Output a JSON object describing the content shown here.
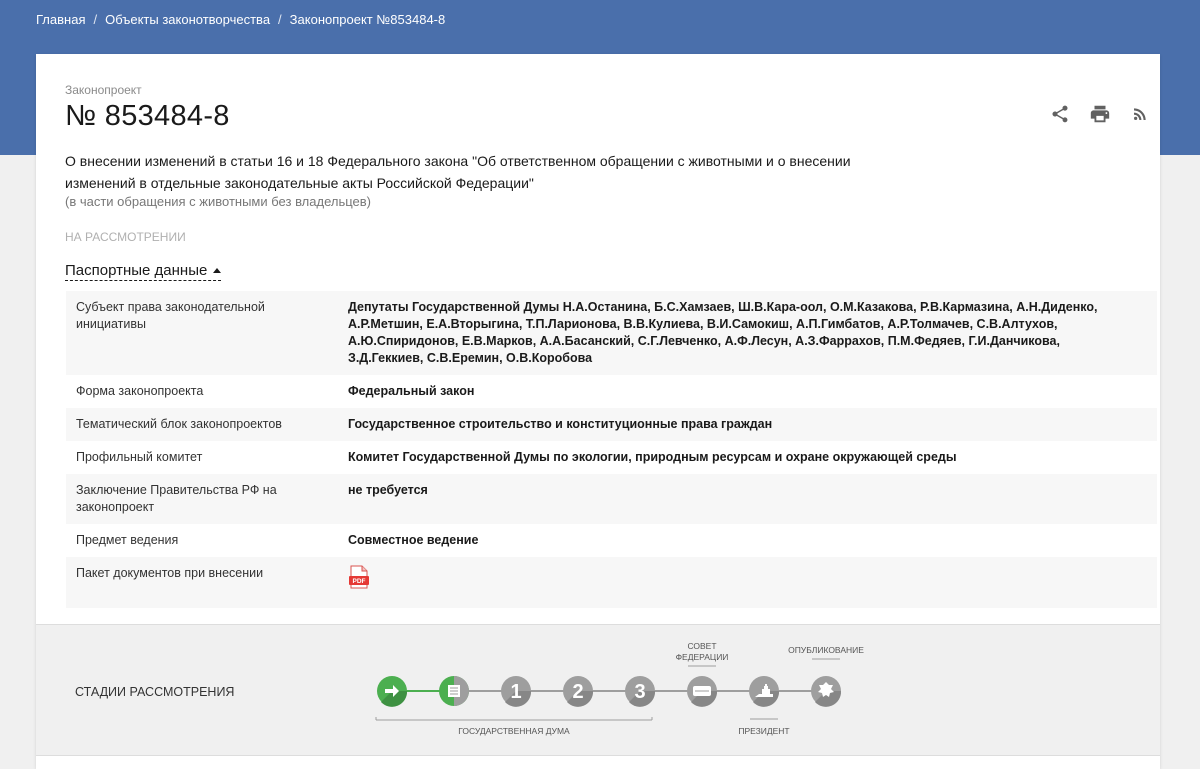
{
  "breadcrumb": [
    {
      "label": "Главная"
    },
    {
      "label": "Объекты законотворчества"
    },
    {
      "label": "Законопроект №853484-8"
    }
  ],
  "doc": {
    "type_label": "Законопроект",
    "number": "№ 853484-8",
    "title": "О внесении изменений в статьи 16 и 18 Федерального закона \"Об ответственном обращении с животными и о внесении изменений в отдельные законодательные акты Российской Федерации\"",
    "subtitle": "(в части обращения с животными без владельцев)",
    "status": "НА РАССМОТРЕНИИ"
  },
  "actions": {
    "share_icon": "share-icon",
    "print_icon": "print-icon",
    "rss_icon": "rss-icon"
  },
  "passport": {
    "toggle_label": "Паспортные данные",
    "rows": [
      {
        "label": "Субъект права законодательной инициативы",
        "value": "Депутаты Государственной Думы Н.А.Останина, Б.С.Хамзаев, Ш.В.Кара-оол, О.М.Казакова, Р.В.Кармазина, А.Н.Диденко, А.Р.Метшин, Е.А.Вторыгина, Т.П.Ларионова, В.В.Кулиева, В.И.Самокиш, А.П.Гимбатов, А.Р.Толмачев, С.В.Алтухов, А.Ю.Спиридонов, Е.В.Марков, А.А.Басанский, С.Г.Левченко, А.Ф.Лесун, А.З.Фаррахов, П.М.Федяев, Г.И.Данчикова, З.Д.Геккиев, С.В.Еремин, О.В.Коробова"
      },
      {
        "label": "Форма законопроекта",
        "value": "Федеральный закон"
      },
      {
        "label": "Тематический блок законопроектов",
        "value": "Государственное строительство и конституционные права граждан"
      },
      {
        "label": "Профильный комитет",
        "value": "Комитет Государственной Думы по экологии, природным ресурсам и охране окружающей среды"
      },
      {
        "label": "Заключение Правительства РФ на законопроект",
        "value": "не требуется"
      },
      {
        "label": "Предмет ведения",
        "value": "Совместное ведение"
      },
      {
        "label": "Пакет документов при внесении",
        "value": ""
      }
    ],
    "pdf_label": "PDF"
  },
  "stages": {
    "label": "СТАДИИ РАССМОТРЕНИЯ",
    "duma_label": "ГОСУДАРСТВЕННАЯ ДУМА",
    "council_label_1": "СОВЕТ",
    "council_label_2": "ФЕДЕРАЦИИ",
    "president_label": "ПРЕЗИДЕНТ",
    "published_label": "ОПУБЛИКОВАНИЕ",
    "step1": "1",
    "step2": "2",
    "step3": "3",
    "colors": {
      "done": "#4caf50",
      "pending": "#9e9e9e"
    }
  }
}
